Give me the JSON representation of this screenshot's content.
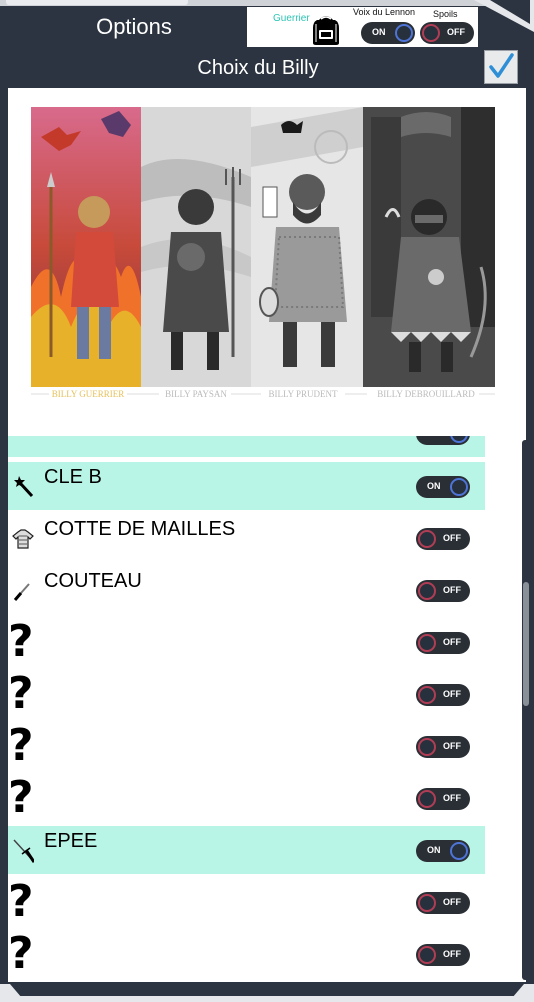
{
  "header": {
    "options_title": "Options",
    "choice_title": "Choix du Billy",
    "class_label": "Guerrier",
    "voice_label": "Voix du Lennon",
    "voice_toggle": "ON",
    "spoils_label": "Spoils",
    "spoils_toggle": "OFF",
    "confirm_icon": "checkmark-icon"
  },
  "banner": {
    "captions": [
      "BILLY GUERRIER",
      "BILLY PAYSAN",
      "BILLY PRUDENT",
      "BILLY DEBROUILLARD"
    ]
  },
  "items": [
    {
      "name": "",
      "icon": "partial-item-icon",
      "state": "ON",
      "highlight": true
    },
    {
      "name": "CLE B",
      "icon": "magic-wand-icon",
      "state": "ON",
      "highlight": true
    },
    {
      "name": "COTTE DE MAILLES",
      "icon": "chainmail-shirt-icon",
      "state": "OFF",
      "highlight": false
    },
    {
      "name": "COUTEAU",
      "icon": "knife-icon",
      "state": "OFF",
      "highlight": false
    },
    {
      "name": "",
      "icon": "question-mark-icon",
      "mark": "?",
      "state": "OFF",
      "highlight": false
    },
    {
      "name": "",
      "icon": "question-mark-icon",
      "mark": "?",
      "state": "OFF",
      "highlight": false
    },
    {
      "name": "",
      "icon": "question-mark-icon",
      "mark": "?",
      "state": "OFF",
      "highlight": false
    },
    {
      "name": "",
      "icon": "question-mark-icon",
      "mark": "?",
      "state": "OFF",
      "highlight": false
    },
    {
      "name": "EPEE",
      "icon": "sword-icon",
      "state": "ON",
      "highlight": true
    },
    {
      "name": "",
      "icon": "question-mark-icon",
      "mark": "?",
      "state": "OFF",
      "highlight": false
    },
    {
      "name": "",
      "icon": "question-mark-icon",
      "mark": "?",
      "state": "OFF",
      "highlight": false
    }
  ],
  "colors": {
    "frame": "#2b3440",
    "highlight": "#b8f5e6",
    "accent": "#2bc5b4",
    "toggle_on": "#4d74d6",
    "toggle_off": "#b13d55"
  }
}
